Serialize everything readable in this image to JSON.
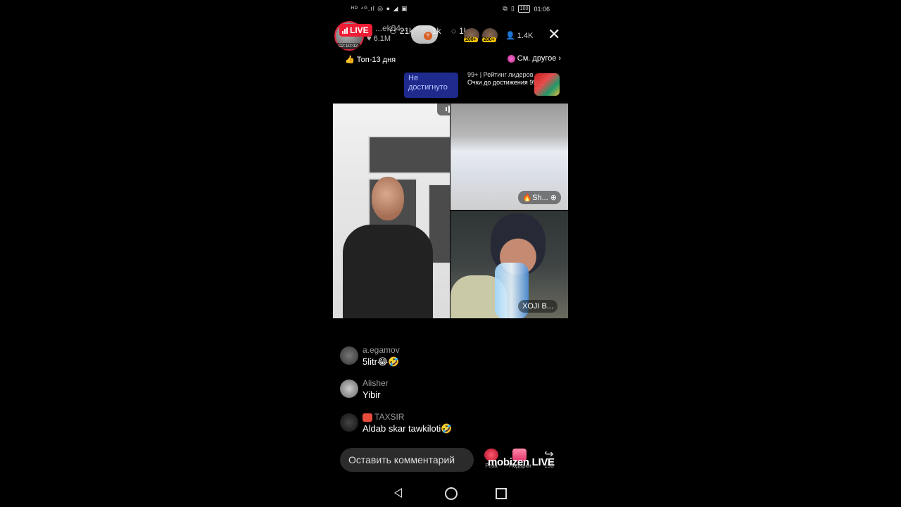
{
  "status_bar": {
    "left_icons": "ᴴᴰ ⁴ᴳ.ıl ◎ ● ◢ ▣",
    "battery": "100",
    "time": "01:06"
  },
  "live": {
    "badge": "LIVE",
    "timer": "02:10:02",
    "host_name": "...ek04...",
    "host_likes": "6.1M",
    "stat_users": "21k",
    "stat_likes": "1k",
    "stat_comments": "1k",
    "avatar_badge_1": "200+",
    "avatar_badge_2": "200+",
    "viewer_count": "1.4K",
    "top_label": "Топ-13 дня",
    "see_other": "См. другое",
    "not_reached": "Не достигнуто",
    "rank_header": "99+ | Рейтинг лидеров",
    "rank_points": "Очки до достижения 99:..."
  },
  "guests": {
    "guest_1": "Sh...",
    "guest_2": "XOJI B..."
  },
  "comments": [
    {
      "user": "a.egamov",
      "text": "5litr😂🤣"
    },
    {
      "user": "Alisher",
      "text": "Yibir"
    },
    {
      "user": "TAXSIR",
      "text": "Aldab skar tawkiloti🤣"
    }
  ],
  "bottom": {
    "comment_placeholder": "Оставить комментарий",
    "rose_label": "Роза",
    "gifts_label": "Подарки",
    "share_label": "153",
    "watermark": "mobizen LIVE"
  },
  "colors": {
    "live_red": "#ee1d35",
    "rank_blue": "#1e2a8c"
  }
}
